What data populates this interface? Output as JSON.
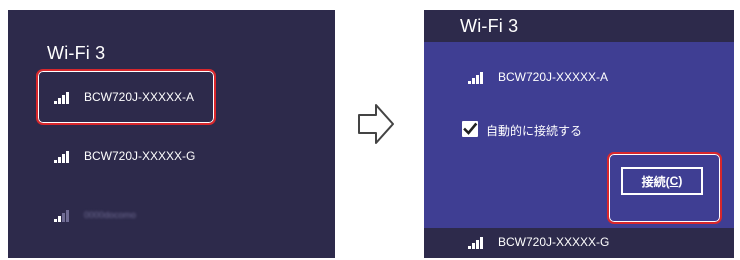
{
  "colors": {
    "panel_bg": "#2d2a4b",
    "expanded_bg": "#3f3e93",
    "highlight": "#d8272c",
    "text": "#ffffff",
    "faded_text": "#6f6b93"
  },
  "left_panel": {
    "title": "Wi-Fi 3",
    "networks": [
      {
        "name": "BCW720J-XXXXX-A",
        "signal_icon": "wifi-signal-icon",
        "highlighted": true
      },
      {
        "name": "BCW720J-XXXXX-G",
        "signal_icon": "wifi-signal-icon",
        "highlighted": false
      },
      {
        "name": "0000docomo",
        "signal_icon": "wifi-signal-weak-icon",
        "highlighted": false,
        "blurred": true
      }
    ]
  },
  "arrow": {
    "icon": "right-arrow-icon"
  },
  "right_panel": {
    "title": "Wi-Fi 3",
    "selected_network": "BCW720J-XXXXX-A",
    "auto_connect_label": "自動的に接続する",
    "auto_connect_checked": true,
    "connect_button": {
      "label": "接続(",
      "accesskey": "C",
      "label_end": ")"
    },
    "other_network": "BCW720J-XXXXX-G"
  }
}
